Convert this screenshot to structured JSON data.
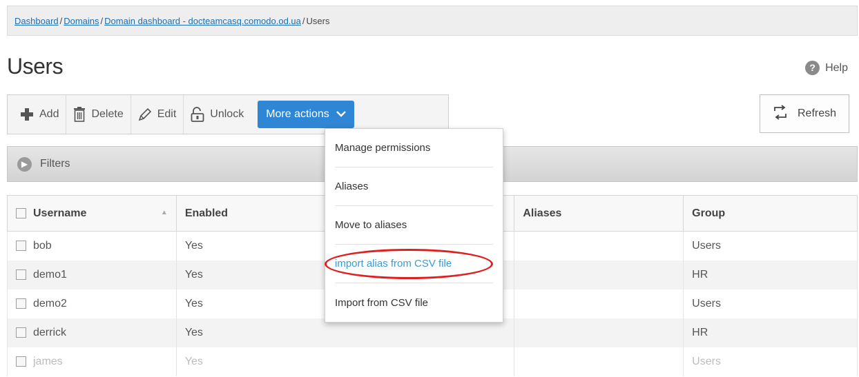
{
  "breadcrumb": {
    "items": [
      "Dashboard",
      "Domains",
      "Domain dashboard - docteamcasq.comodo.od.ua",
      "Users"
    ]
  },
  "page": {
    "title": "Users",
    "help_label": "Help",
    "help_icon": "?"
  },
  "toolbar": {
    "add_label": "Add",
    "delete_label": "Delete",
    "edit_label": "Edit",
    "unlock_label": "Unlock",
    "more_actions_label": "More actions",
    "refresh_label": "Refresh"
  },
  "filters": {
    "label": "Filters"
  },
  "table": {
    "columns": [
      "Username",
      "Enabled",
      "Aliases",
      "Group"
    ],
    "rows": [
      {
        "username": "bob",
        "enabled": "Yes",
        "aliases": "",
        "group": "Users"
      },
      {
        "username": "demo1",
        "enabled": "Yes",
        "aliases": "",
        "group": "HR"
      },
      {
        "username": "demo2",
        "enabled": "Yes",
        "aliases": "",
        "group": "Users"
      },
      {
        "username": "derrick",
        "enabled": "Yes",
        "aliases": "",
        "group": "HR"
      },
      {
        "username": "james",
        "enabled": "Yes",
        "aliases": "",
        "group": "Users"
      }
    ]
  },
  "more_actions_menu": {
    "items": [
      "Manage permissions",
      "Aliases",
      "Move to aliases",
      "import alias from CSV file",
      "Import from CSV file"
    ]
  },
  "colors": {
    "accent": "#2f86d4",
    "highlight_text": "#3a9ad9",
    "annotation": "#e02020"
  }
}
